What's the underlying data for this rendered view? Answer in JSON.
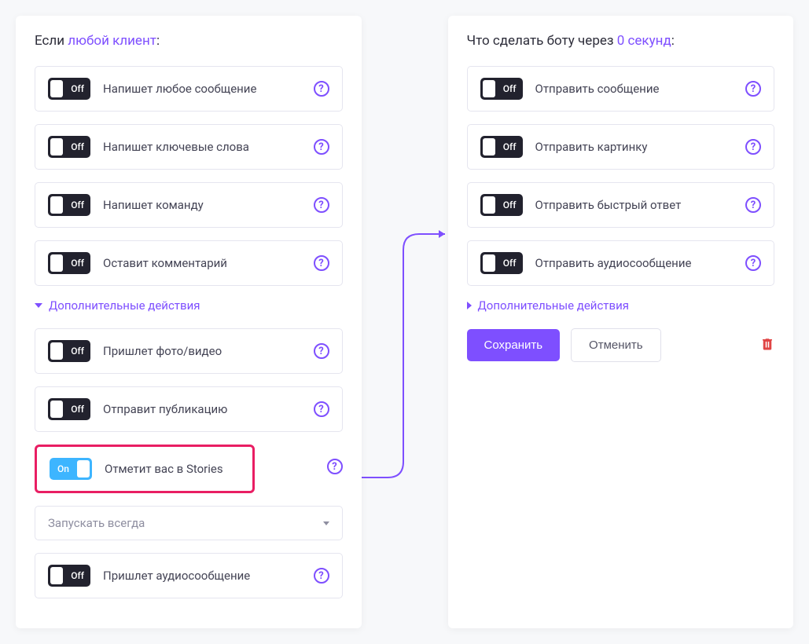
{
  "left": {
    "header_prefix": "Если ",
    "header_accent": "любой клиент",
    "header_suffix": ":",
    "triggers": [
      {
        "state": "off",
        "label": "Напишет любое сообщение"
      },
      {
        "state": "off",
        "label": "Напишет ключевые слова"
      },
      {
        "state": "off",
        "label": "Напишет команду"
      },
      {
        "state": "off",
        "label": "Оставит комментарий"
      }
    ],
    "extra_label": "Дополнительные действия",
    "extra_triggers": [
      {
        "state": "off",
        "label": "Пришлет фото/видео"
      },
      {
        "state": "off",
        "label": "Отправит публикацию"
      },
      {
        "state": "on",
        "label": "Отметит вас в Stories",
        "highlight": true
      },
      {
        "state": "off",
        "label": "Пришлет аудиосообщение"
      }
    ],
    "select_value": "Запускать всегда"
  },
  "right": {
    "header_prefix": "Что сделать боту через ",
    "header_accent": "0 секунд",
    "header_suffix": ":",
    "actions": [
      {
        "state": "off",
        "label": "Отправить сообщение"
      },
      {
        "state": "off",
        "label": "Отправить картинку"
      },
      {
        "state": "off",
        "label": "Отправить быстрый ответ"
      },
      {
        "state": "off",
        "label": "Отправить аудиосообщение"
      }
    ],
    "extra_label": "Дополнительные действия",
    "save": "Сохранить",
    "cancel": "Отменить"
  },
  "toggle_text": {
    "on": "On",
    "off": "Off"
  }
}
